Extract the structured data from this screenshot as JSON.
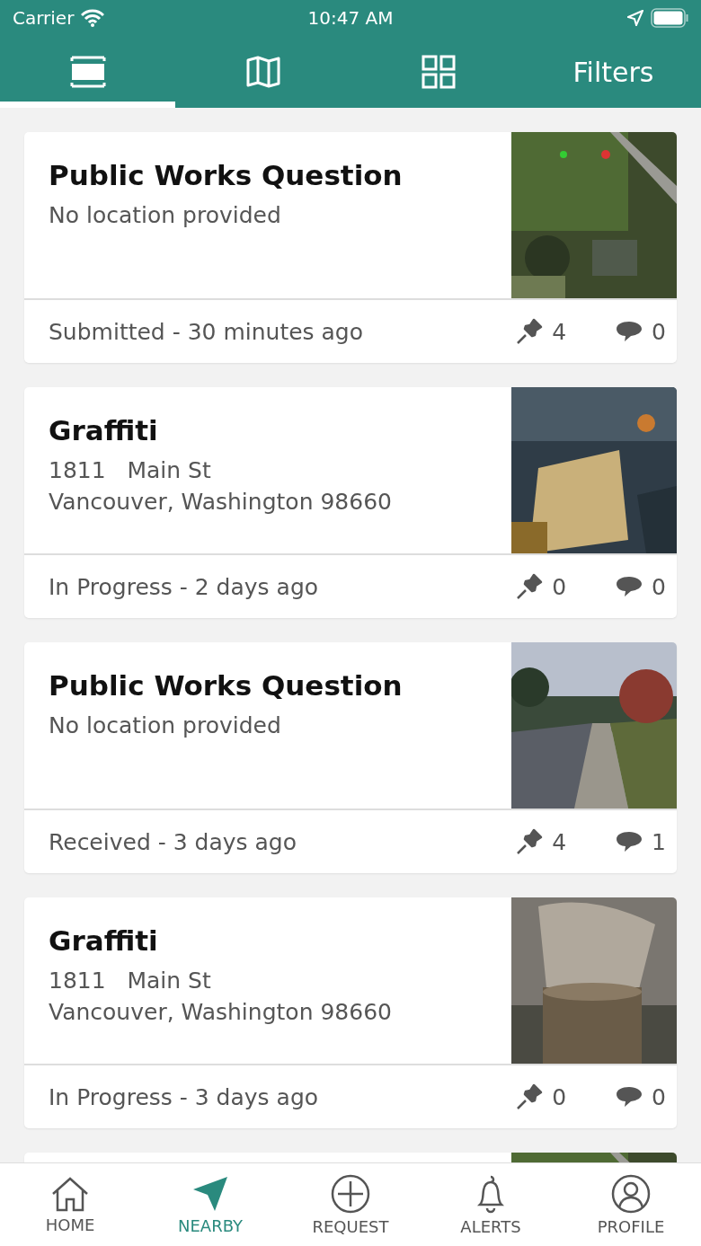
{
  "status_bar": {
    "carrier": "Carrier",
    "time": "10:47 AM"
  },
  "tabs": [
    {
      "kind": "list",
      "selected": true
    },
    {
      "kind": "map",
      "selected": false
    },
    {
      "kind": "grid",
      "selected": false
    },
    {
      "kind": "text",
      "label": "Filters",
      "selected": false
    }
  ],
  "cards": [
    {
      "kind": "full",
      "title": "Public Works Question",
      "lines": [
        "No location provided"
      ],
      "status": "Submitted - 30 minutes ago",
      "pins": "4",
      "comments": "0"
    },
    {
      "kind": "full",
      "title": "Graffiti",
      "lines": [
        "1811   Main St",
        "Vancouver, Washington 98660"
      ],
      "status": "In Progress - 2 days ago",
      "pins": "0",
      "comments": "0"
    },
    {
      "kind": "full",
      "title": "Public Works Question",
      "lines": [
        "No location provided"
      ],
      "status": "Received - 3 days ago",
      "pins": "4",
      "comments": "1"
    },
    {
      "kind": "full",
      "title": "Graffiti",
      "lines": [
        "1811   Main St",
        "Vancouver, Washington 98660"
      ],
      "status": "In Progress - 3 days ago",
      "pins": "0",
      "comments": "0"
    },
    {
      "kind": "peek"
    }
  ],
  "nav": [
    {
      "kind": "home",
      "label": "HOME",
      "selected": false
    },
    {
      "kind": "nearby",
      "label": "NEARBY",
      "selected": true
    },
    {
      "kind": "request",
      "label": "REQUEST",
      "selected": false
    },
    {
      "kind": "alerts",
      "label": "ALERTS",
      "selected": false
    },
    {
      "kind": "profile",
      "label": "PROFILE",
      "selected": false
    }
  ]
}
